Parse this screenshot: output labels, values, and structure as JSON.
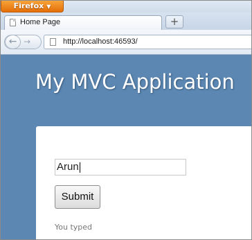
{
  "browser": {
    "app_button_label": "Firefox",
    "tab_title": "Home Page",
    "new_tab_symbol": "+",
    "url": "http://localhost:46593/",
    "back_symbol": "←",
    "forward_symbol": "→"
  },
  "page": {
    "site_title": "My MVC Application",
    "name_input_value": "Arun",
    "submit_label": "Submit",
    "result_label": "You typed"
  },
  "colors": {
    "firefox_button": "#e56f08",
    "page_background": "#5c87b2",
    "content_background": "#ffffff"
  },
  "icons": [
    "page-icon",
    "back-arrow-icon",
    "forward-arrow-icon",
    "new-tab-plus-icon"
  ]
}
